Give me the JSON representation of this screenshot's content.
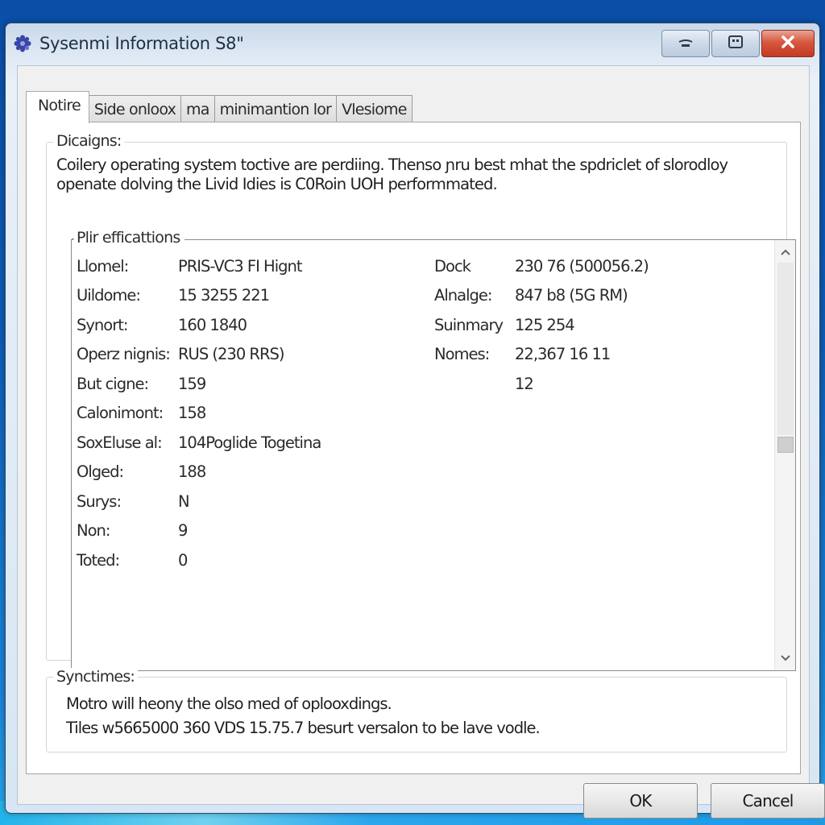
{
  "window": {
    "title": "Sysenmi Information S8\"",
    "icon": "gear-cog-icon",
    "caption_buttons": {
      "minimize_icon": "minimize-icon",
      "maximize_icon": "restore-icon",
      "close_icon": "close-icon",
      "close_color": "#d6573f"
    }
  },
  "tabs": [
    {
      "label": "Notire",
      "active": true
    },
    {
      "label": "Side onloox",
      "active": false
    },
    {
      "label": "ma",
      "active": false
    },
    {
      "label": "minimantion lor",
      "active": false
    },
    {
      "label": "Vlesiome",
      "active": false
    }
  ],
  "description": {
    "label": "Dicaigns:",
    "line1": "Coilery operating system toctive are perdiing. Thenso ɲru best mhat the spdriclet of slorodloy",
    "line2": "openate dolving the Livid Idies is C0Roin UOH performmated."
  },
  "specifications": {
    "label": "Plir efficattions",
    "left": [
      {
        "key": "Llomel:",
        "value": "PRIS-VC3  FI Hignt"
      },
      {
        "key": "Uildome:",
        "value": "15 3255 221"
      },
      {
        "key": "Synort:",
        "value": "160 1840"
      },
      {
        "key": "Operz nignis:",
        "value": "RUS (230 RRS)"
      },
      {
        "key": "But cigne:",
        "value": "159"
      },
      {
        "key": "Calonimont:",
        "value": "158"
      },
      {
        "key": "SoxEluse al:",
        "value": "104Poglide Togetina"
      },
      {
        "key": "Olged:",
        "value": "188"
      },
      {
        "key": "Surys:",
        "value": "N"
      },
      {
        "key": "Non:",
        "value": "9"
      },
      {
        "key": "Toted:",
        "value": "0"
      }
    ],
    "right": [
      {
        "key": "Dock",
        "value": "230 76 (500056.2)"
      },
      {
        "key": "Alnalge:",
        "value": "847 b8 (5G RM)"
      },
      {
        "key": "Suinmary",
        "value": "125 254"
      },
      {
        "key": "Nomes:",
        "value": "22,367 16 11"
      },
      {
        "key": "",
        "value": "12"
      }
    ],
    "scrollbar": {
      "up_icon": "scroll-up-arrow-icon",
      "down_icon": "scroll-down-arrow-icon",
      "position_fraction": 0.47
    }
  },
  "sync": {
    "label": "Synctimes:",
    "line1": "Motro will heony the olso med of oplooxdings.",
    "line2": "Tiles w5665000 360 VDS 15.75.7 besurt versalon to be lave vodle."
  },
  "buttons": {
    "ok": "OK",
    "cancel": "Cancel"
  }
}
